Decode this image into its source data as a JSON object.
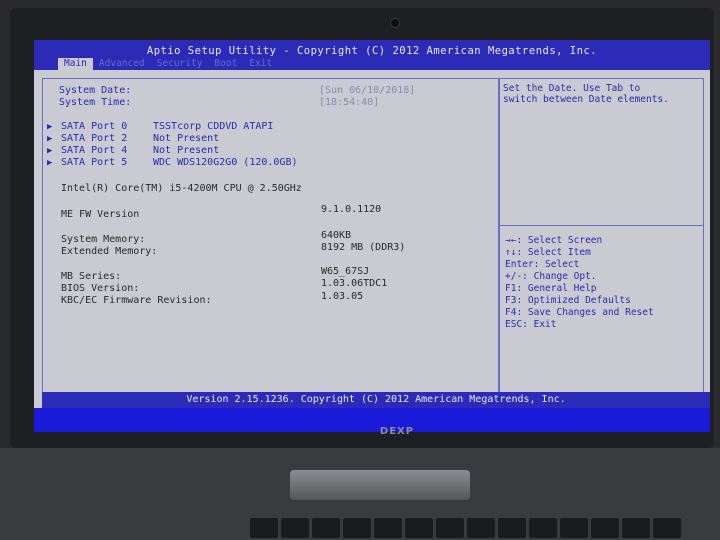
{
  "title": "Aptio Setup Utility - Copyright (C) 2012 American Megatrends, Inc.",
  "tabs": [
    {
      "label": "Main",
      "active": true
    },
    {
      "label": "Advanced",
      "active": false
    },
    {
      "label": "Security",
      "active": false
    },
    {
      "label": "Boot",
      "active": false
    },
    {
      "label": "Exit",
      "active": false
    }
  ],
  "system_date": {
    "label": "System Date:",
    "value": "[Sun 06/10/2018]"
  },
  "system_time": {
    "label": "System Time:",
    "value": "[18:54:40]"
  },
  "sata_ports": [
    {
      "label": "SATA Port 0",
      "value": "TSSTcorp CDDVD ATAPI"
    },
    {
      "label": "SATA Port 2",
      "value": "Not Present"
    },
    {
      "label": "SATA Port 4",
      "value": "Not Present"
    },
    {
      "label": "SATA Port 5",
      "value": "WDC WDS120G2G0 (120.0GB)"
    }
  ],
  "cpu": "Intel(R) Core(TM) i5-4200M CPU @ 2.50GHz",
  "me_fw": {
    "label": "ME FW Version",
    "value": "9.1.0.1120"
  },
  "system_memory": {
    "label": "System Memory:",
    "value": "640KB"
  },
  "extended_memory": {
    "label": "Extended Memory:",
    "value": "8192 MB (DDR3)"
  },
  "mb_series": {
    "label": "MB Series:",
    "value": "W65_67SJ"
  },
  "bios_version": {
    "label": "BIOS Version:",
    "value": "1.03.06TDC1"
  },
  "kbc_fw": {
    "label": "KBC/EC Firmware Revision:",
    "value": "1.03.05"
  },
  "help_text": "Set the Date. Use Tab to\nswitch between Date elements.",
  "keys_help": [
    "→←: Select Screen",
    "↑↓: Select Item",
    "Enter: Select",
    "+/-: Change Opt.",
    "F1: General Help",
    "F3: Optimized Defaults",
    "F4: Save Changes and Reset",
    "ESC: Exit"
  ],
  "status": "Version 2.15.1236. Copyright (C) 2012 American Megatrends, Inc.",
  "brand": "DEXP",
  "colors": {
    "bios_blue": "#2b2bb8",
    "bios_grey": "#c9cad2",
    "text_blue": "#2b2bb0"
  }
}
